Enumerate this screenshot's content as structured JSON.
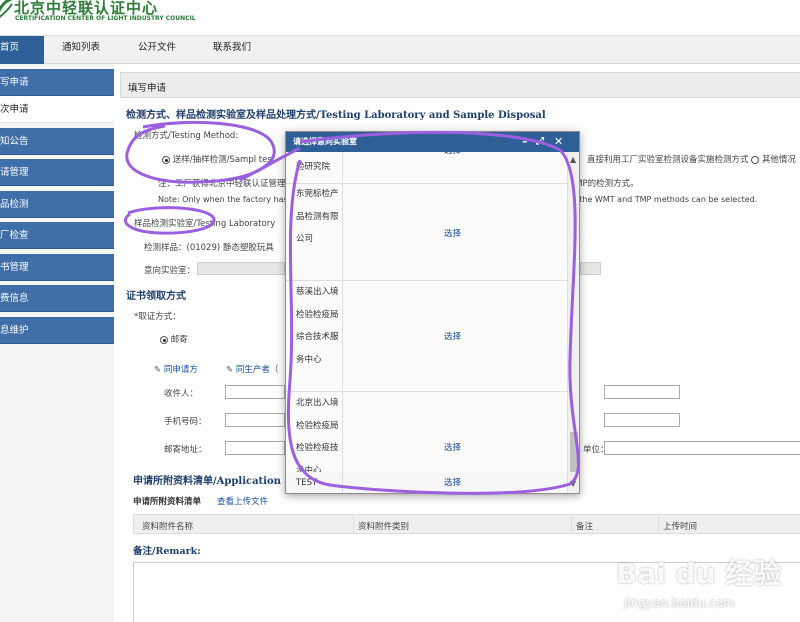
{
  "header": {
    "logo_cn": "北京中轻联认证中心",
    "logo_en": "CERTIFICATION CENTER OF LIGHT INDUSTRY COUNCIL"
  },
  "nav": {
    "items": [
      "首页",
      "通知列表",
      "公开文件",
      "联系我们"
    ]
  },
  "sidebar": {
    "items": [
      "写申请",
      "次申请",
      "知公告",
      "请管理",
      "品检测",
      "厂检查",
      "书管理",
      "费信息",
      "息维护"
    ]
  },
  "main": {
    "page_title": "填写申请",
    "section1_title": "检测方式、样品检测实验室及样品处理方式/Testing Laboratory and Sample Disposal",
    "testing_method_label": "检测方式/Testing Method:",
    "option1_text": "送样/抽样检测/Sampl",
    "option1_suffix": "test",
    "option2_text": "直接利用工厂实验室检测设备实施检测方式",
    "option3_text": "其他情况",
    "note_cn": "注：工厂获得北京中轻联认证管理",
    "note_cn_tail": "TMP的检测方式。",
    "note_en": "Note: Only when the factory has th",
    "note_en_tail": "s, the WMT and TMP methods can be selected.",
    "lab_label": "样品检测实验室/Testing Laboratory",
    "sample_label": "检测样品：(01029) 静态塑胶玩具",
    "intended_lab_label": "意向实验室：",
    "section2_title": "证书领取方式",
    "cert_method_label": "*取证方式：",
    "mail_option": "邮寄",
    "same_as_applicant": "同申请方",
    "same_as_producer": "同生产者（",
    "recipient_label": "收件人：",
    "phone_label": "手机号码：",
    "address_label": "邮寄地址：",
    "unit_label": "单位：",
    "section3_title": "申请所附资料清单/Application",
    "attach_list_label": "申请所附资料清单",
    "view_upload_link": "查看上传文件",
    "att_columns": [
      "资料附件名称",
      "资料附件类别",
      "备注",
      "上传时间"
    ],
    "remark_title": "备注/Remark:"
  },
  "modal": {
    "title": "请选择意向实验室",
    "rows": [
      {
        "name": "验研究院",
        "action": "选择"
      },
      {
        "name": "东莞标检产品检测有限公司",
        "action": "选择"
      },
      {
        "name": "慈溪出入境检验检疫局综合技术服务中心",
        "action": "选择"
      },
      {
        "name": "北京出入境检验检疫局检验检疫技术中心",
        "action": "选择"
      },
      {
        "name": "TEST",
        "action": "选择"
      }
    ]
  },
  "watermark": {
    "brand": "Bai du 经验",
    "url": "jingyan.baidu.com"
  },
  "colors": {
    "nav_active": "#2f5f97",
    "sidebar": "#3f6ea8",
    "annotation": "#9b5fe0",
    "link": "#1a4fa0"
  }
}
